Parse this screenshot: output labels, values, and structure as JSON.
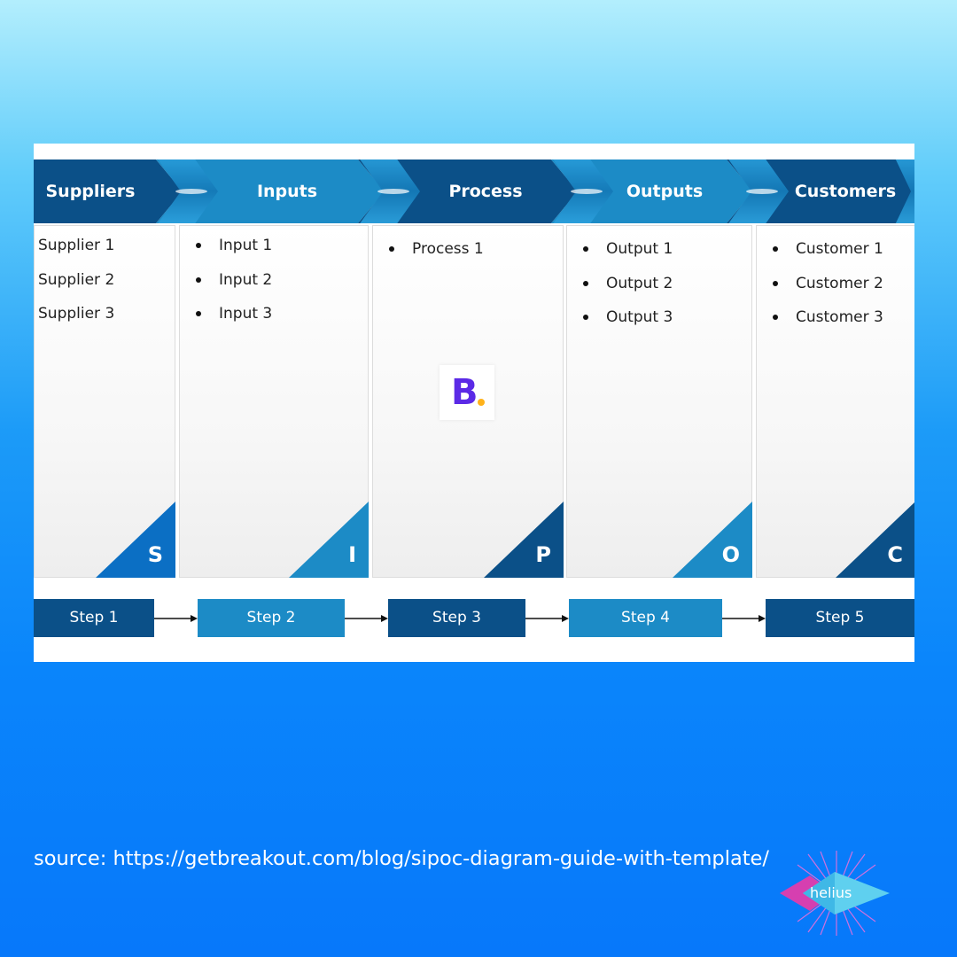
{
  "stages": [
    {
      "title": "Suppliers",
      "letter": "S",
      "items": [
        "Supplier 1",
        "Supplier 2",
        "Supplier 3"
      ]
    },
    {
      "title": "Inputs",
      "letter": "I",
      "items": [
        "Input 1",
        "Input 2",
        "Input 3"
      ]
    },
    {
      "title": "Process",
      "letter": "P",
      "items": [
        "Process 1"
      ]
    },
    {
      "title": "Outputs",
      "letter": "O",
      "items": [
        "Output 1",
        "Output 2",
        "Output 3"
      ]
    },
    {
      "title": "Customers",
      "letter": "C",
      "items": [
        "Customer 1",
        "Customer 2",
        "Customer 3"
      ]
    }
  ],
  "steps": [
    "Step 1",
    "Step 2",
    "Step 3",
    "Step 4",
    "Step 5"
  ],
  "center_logo": {
    "letter": "B",
    "icon": "breakout-logo-icon"
  },
  "source_text": "source: https://getbreakout.com/blog/sipoc-diagram-guide-with-template/",
  "brand_logo": {
    "text": "helius",
    "icon": "helius-logo-icon"
  },
  "colors": {
    "dark_blue": "#0b5088",
    "light_blue": "#1c8bc6",
    "logo_purple": "#5b2ae6",
    "logo_dot": "#ffb21a"
  }
}
